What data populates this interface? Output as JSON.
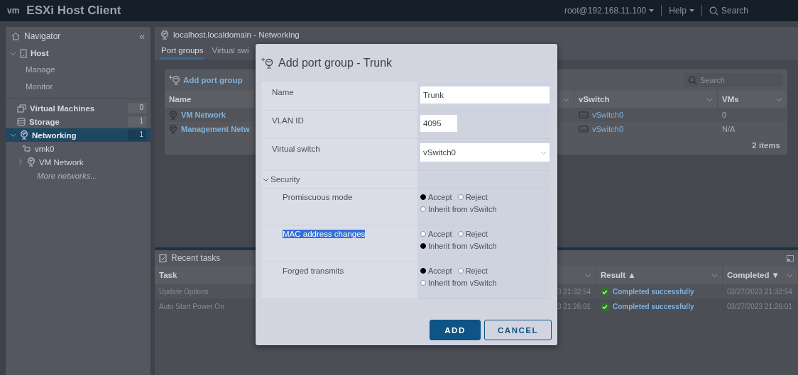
{
  "topbar": {
    "logo": "vm",
    "title": "ESXi Host Client",
    "user": "root@192.168.11.100",
    "help": "Help",
    "search": "Search"
  },
  "navigator": {
    "title": "Navigator",
    "collapse": "«",
    "items": [
      {
        "label": "Host",
        "expanded": true,
        "selected": false,
        "children": [
          {
            "label": "Manage"
          },
          {
            "label": "Monitor"
          }
        ]
      },
      {
        "label": "Virtual Machines",
        "count": "0",
        "selected": false
      },
      {
        "label": "Storage",
        "count": "1",
        "selected": false
      },
      {
        "label": "Networking",
        "count": "1",
        "selected": true,
        "expanded": true,
        "children": [
          {
            "label": "vmk0",
            "kind": "nic"
          },
          {
            "label": "VM Network",
            "kind": "network",
            "expanded": false
          },
          {
            "label": "More networks...",
            "kind": "more"
          }
        ]
      }
    ]
  },
  "content": {
    "title": "localhost.localdomain - Networking",
    "tabs": [
      {
        "label": "Port groups",
        "selected": true
      },
      {
        "label": "Virtual swi",
        "selected": false
      }
    ],
    "toolbar": {
      "add": "Add port group",
      "search": "Search"
    },
    "columns": [
      "Name",
      "vSwitch",
      "VMs"
    ],
    "rows": [
      {
        "name": "VM Network",
        "vswitch": "vSwitch0",
        "vms": "0"
      },
      {
        "name": "Management Netw",
        "vswitch": "vSwitch0",
        "vms": "N/A"
      }
    ],
    "footer": "2 items"
  },
  "tasks": {
    "title": "Recent tasks",
    "columns": [
      "Task",
      "Result ▲",
      "Completed ▼"
    ],
    "rows": [
      {
        "task": "Update Options",
        "time": "3 21:32:54",
        "result": "Completed successfully",
        "completed": "03/27/2023 21:32:54"
      },
      {
        "task": "Auto Start Power On",
        "time": "3 21:26:01",
        "result": "Completed successfully",
        "completed": "03/27/2023 21:26:01"
      }
    ]
  },
  "dialog": {
    "title": "Add port group - Trunk",
    "fields": [
      {
        "label": "Name",
        "kind": "text",
        "value": "Trunk"
      },
      {
        "label": "VLAN ID",
        "kind": "short",
        "value": "4095"
      },
      {
        "label": "Virtual switch",
        "kind": "select",
        "value": "vSwitch0"
      }
    ],
    "security": {
      "label": "Security",
      "expanded": true,
      "items": [
        {
          "label": "Promiscuous mode",
          "highlighted": false,
          "options": [
            {
              "label": "Accept",
              "selected": true
            },
            {
              "label": "Reject",
              "selected": false
            },
            {
              "label": "Inherit from vSwitch",
              "selected": false
            }
          ]
        },
        {
          "label": "MAC address changes",
          "highlighted": true,
          "options": [
            {
              "label": "Accept",
              "selected": false
            },
            {
              "label": "Reject",
              "selected": false
            },
            {
              "label": "Inherit from vSwitch",
              "selected": true
            }
          ]
        },
        {
          "label": "Forged transmits",
          "highlighted": false,
          "options": [
            {
              "label": "Accept",
              "selected": true
            },
            {
              "label": "Reject",
              "selected": false
            },
            {
              "label": "Inherit from vSwitch",
              "selected": false
            }
          ]
        }
      ]
    },
    "buttons": [
      {
        "label": "ADD",
        "kind": "primary"
      },
      {
        "label": "CANCEL",
        "kind": "secondary"
      }
    ]
  }
}
